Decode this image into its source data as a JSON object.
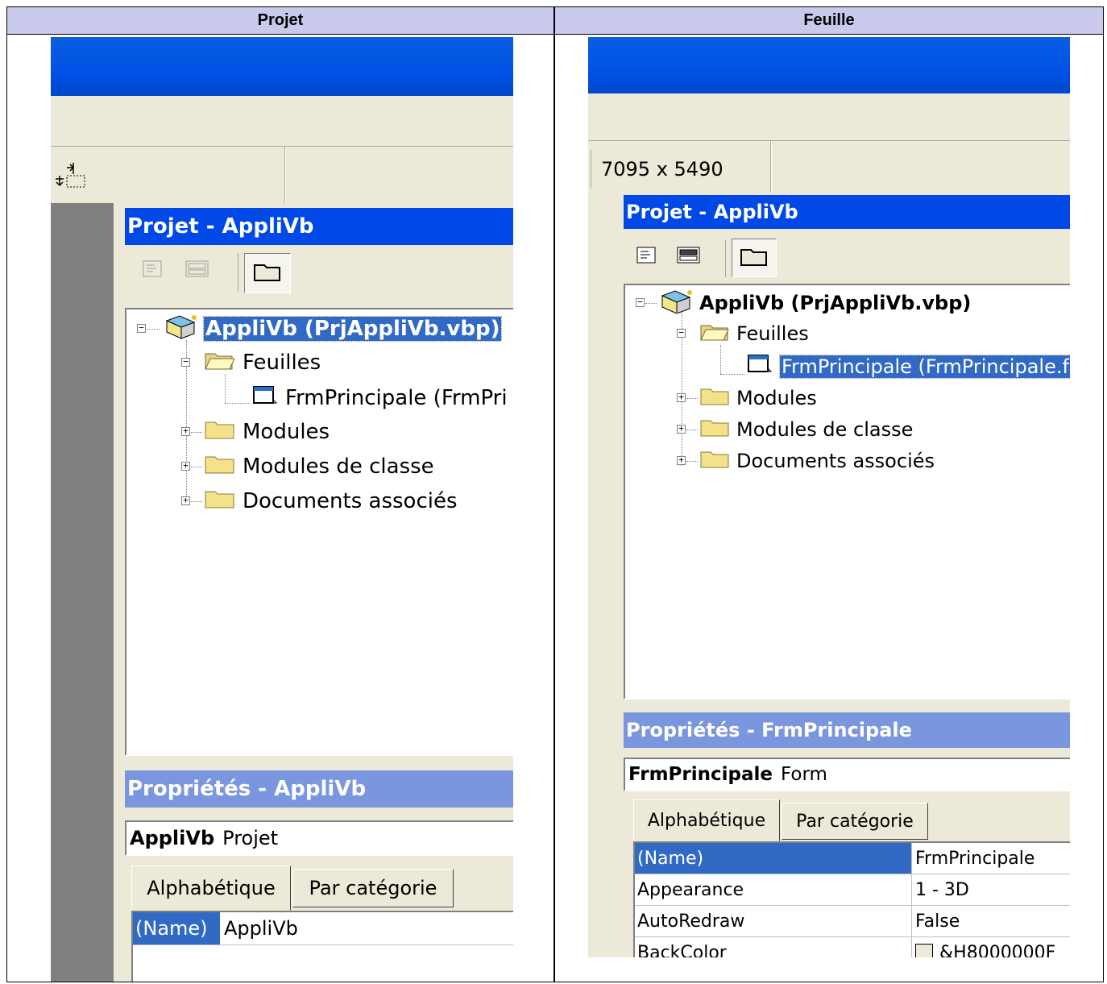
{
  "columns": {
    "left_header": "Projet",
    "right_header": "Feuille"
  },
  "left": {
    "project_title": "Projet - AppliVb",
    "tree": {
      "root": "AppliVb (PrjAppliVb.vbp)",
      "forms_folder": "Feuilles",
      "form_item": "FrmPrincipale (FrmPri",
      "modules": "Modules",
      "class_modules": "Modules de classe",
      "related_docs": "Documents associés"
    },
    "properties_title": "Propriétés - AppliVb",
    "object_name": "AppliVb",
    "object_type": "Projet",
    "tabs": [
      "Alphabétique",
      "Par catégorie"
    ],
    "grid": [
      {
        "name": "(Name)",
        "value": "AppliVb"
      }
    ]
  },
  "right": {
    "status_size": "7095 x 5490",
    "project_title": "Projet - AppliVb",
    "tree": {
      "root": "AppliVb (PrjAppliVb.vbp)",
      "forms_folder": "Feuilles",
      "form_item": "FrmPrincipale (FrmPrincipale.fr",
      "modules": "Modules",
      "class_modules": "Modules de classe",
      "related_docs": "Documents associés"
    },
    "properties_title": "Propriétés - FrmPrincipale",
    "object_name": "FrmPrincipale",
    "object_type": "Form",
    "tabs": [
      "Alphabétique",
      "Par catégorie"
    ],
    "grid": [
      {
        "name": "(Name)",
        "value": "FrmPrincipale"
      },
      {
        "name": "Appearance",
        "value": "1 - 3D"
      },
      {
        "name": "AutoRedraw",
        "value": "False"
      },
      {
        "name": "BackColor",
        "value": "&H8000000F"
      }
    ]
  },
  "icons": [
    "view-code-icon",
    "view-object-icon",
    "toggle-folders-icon",
    "project-icon",
    "open-folder-icon",
    "form-icon",
    "folder-icon",
    "align-icon",
    "color-swatch-icon"
  ],
  "colors": {
    "header_bg": "#c9c9ec",
    "active_title": "#0049e6",
    "inactive_title": "#7a96df",
    "selection": "#316ac5",
    "window_bg": "#ece9d8"
  }
}
